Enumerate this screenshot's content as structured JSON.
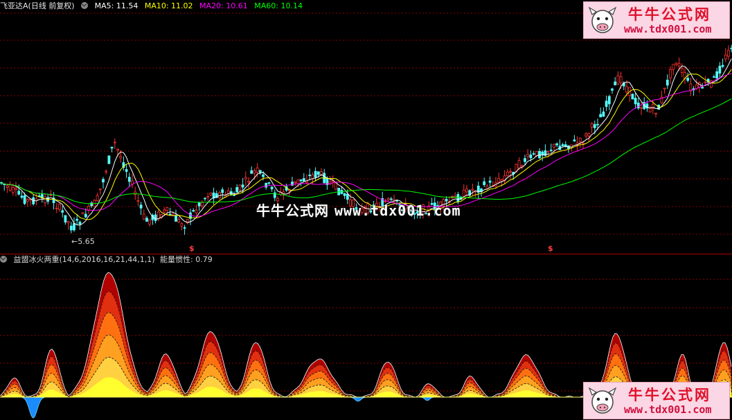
{
  "header": {
    "stock": "飞亚达A(日线 前复权)",
    "ma5": "MA5: 11.54",
    "ma10": "MA10: 11.02",
    "ma20": "MA20: 10.61",
    "ma60": "MA60: 10.14"
  },
  "indicator": {
    "name": "益盟冰火两重(14,6,2016,16,21,44,1,1)",
    "value": "能量惯性: 0.79"
  },
  "price_label": "←5.65",
  "markers": [
    "$",
    "$"
  ],
  "watermark": {
    "cn": "牛牛公式网",
    "url": "www.tdx001.com"
  },
  "badge": {
    "title": "牛牛公式网",
    "url": "www.tdx001.com"
  },
  "colors": {
    "ma5": "#ffffff",
    "ma10": "#ffff00",
    "ma20": "#ff00ff",
    "ma60": "#00ff00",
    "up": "#ff3232",
    "down": "#54fcfc",
    "grid": "#8b0000"
  },
  "icons": [
    "settings-toggle-icon",
    "cow-logo-icon"
  ]
}
